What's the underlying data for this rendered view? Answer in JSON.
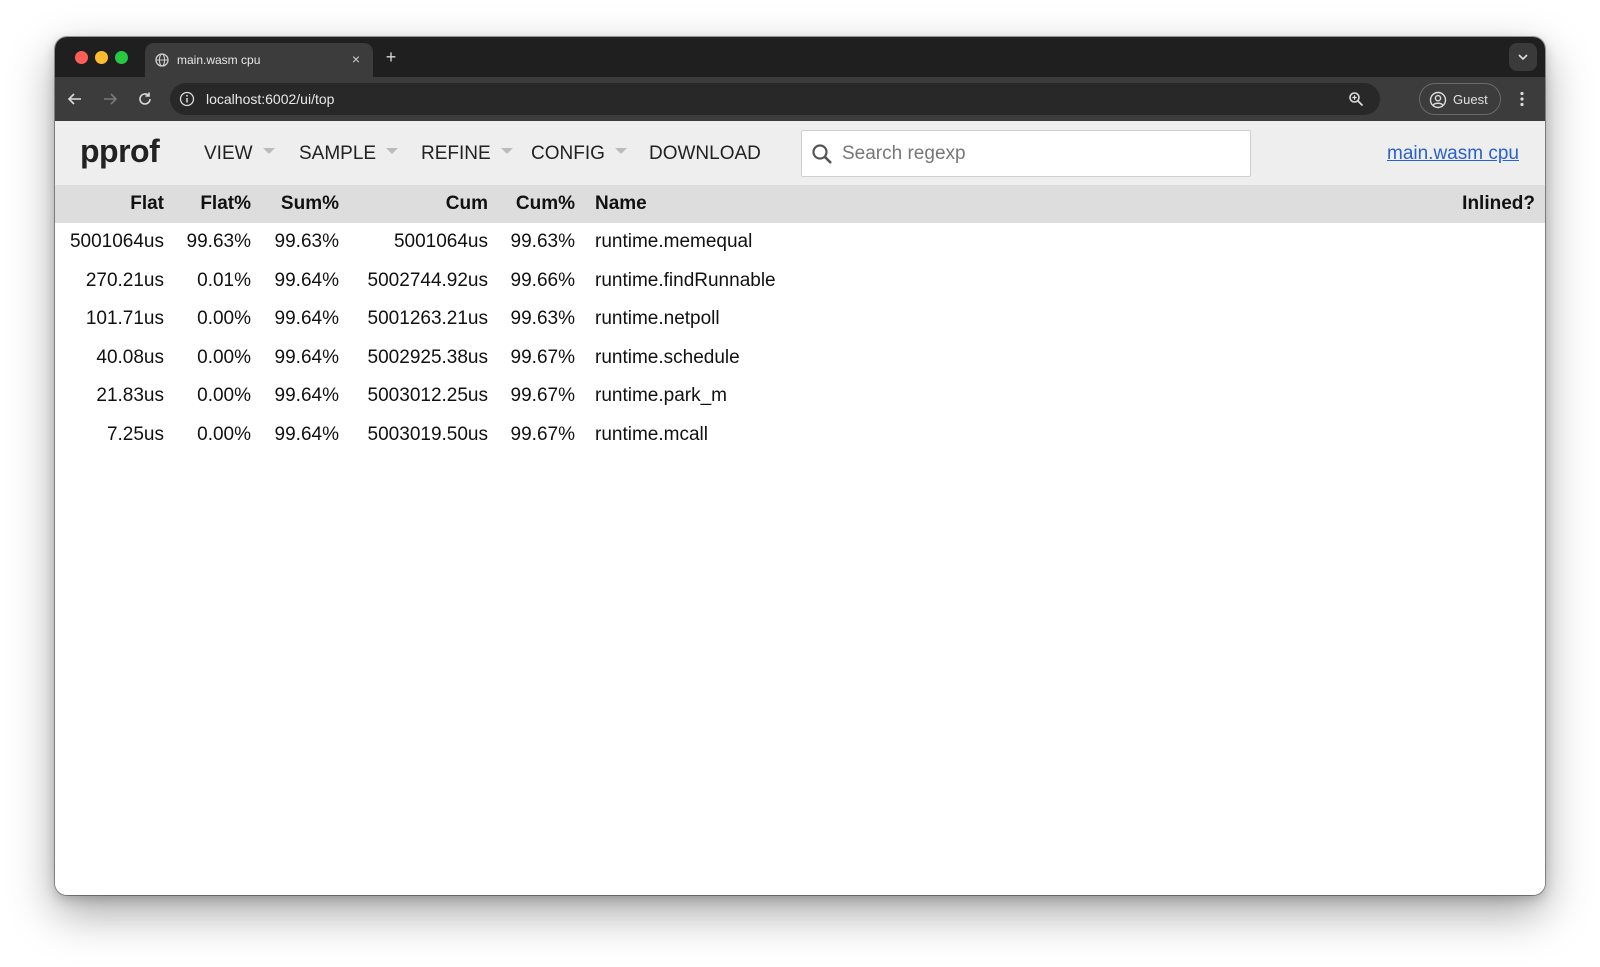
{
  "browser": {
    "tab_title": "main.wasm cpu",
    "tab_close": "×",
    "new_tab": "+",
    "url": "localhost:6002/ui/top",
    "profile_label": "Guest"
  },
  "header": {
    "logo": "pprof",
    "menus": [
      "VIEW",
      "SAMPLE",
      "REFINE",
      "CONFIG"
    ],
    "download": "DOWNLOAD",
    "search_placeholder": "Search regexp",
    "profile_link": "main.wasm cpu"
  },
  "table": {
    "columns": [
      "Flat",
      "Flat%",
      "Sum%",
      "Cum",
      "Cum%",
      "Name",
      "Inlined?"
    ],
    "rows": [
      [
        "5001064us",
        "99.63%",
        "99.63%",
        "5001064us",
        "99.63%",
        "runtime.memequal",
        ""
      ],
      [
        "270.21us",
        "0.01%",
        "99.64%",
        "5002744.92us",
        "99.66%",
        "runtime.findRunnable",
        ""
      ],
      [
        "101.71us",
        "0.00%",
        "99.64%",
        "5001263.21us",
        "99.63%",
        "runtime.netpoll",
        ""
      ],
      [
        "40.08us",
        "0.00%",
        "99.64%",
        "5002925.38us",
        "99.67%",
        "runtime.schedule",
        ""
      ],
      [
        "21.83us",
        "0.00%",
        "99.64%",
        "5003012.25us",
        "99.67%",
        "runtime.park_m",
        ""
      ],
      [
        "7.25us",
        "0.00%",
        "99.64%",
        "5003019.50us",
        "99.67%",
        "runtime.mcall",
        ""
      ]
    ]
  },
  "icons": {
    "tab_favicon": "globe-icon",
    "back": "arrow-left-icon",
    "forward": "arrow-right-icon",
    "reload": "reload-icon",
    "site_info": "info-icon",
    "zoom": "zoom-icon",
    "profile": "user-circle-icon",
    "menu": "more-vert-icon",
    "search": "search-icon"
  },
  "colors": {
    "header_bg": "#eeeeee",
    "table_header_bg": "#dddddd",
    "link": "#2a62c9"
  }
}
